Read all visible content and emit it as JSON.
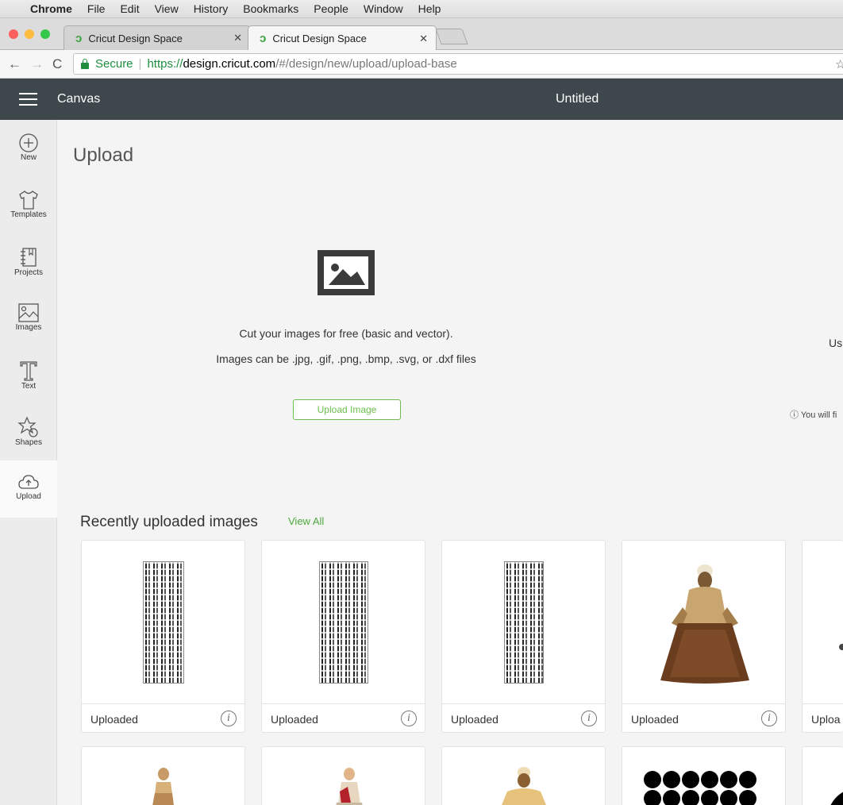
{
  "menubar": {
    "app": "Chrome",
    "items": [
      "File",
      "Edit",
      "View",
      "History",
      "Bookmarks",
      "People",
      "Window",
      "Help"
    ]
  },
  "tabs": [
    {
      "title": "Cricut Design Space",
      "active": false
    },
    {
      "title": "Cricut Design Space",
      "active": true
    }
  ],
  "address": {
    "secure_label": "Secure",
    "scheme": "https://",
    "host": "design.cricut.com",
    "path": "/#/design/new/upload/upload-base"
  },
  "header": {
    "canvas_label": "Canvas",
    "document_title": "Untitled"
  },
  "rail": [
    {
      "label": "New",
      "icon": "plus-circle-icon",
      "active": false
    },
    {
      "label": "Templates",
      "icon": "shirt-icon",
      "active": false
    },
    {
      "label": "Projects",
      "icon": "notebook-icon",
      "active": false
    },
    {
      "label": "Images",
      "icon": "image-icon",
      "active": false
    },
    {
      "label": "Text",
      "icon": "text-t-icon",
      "active": false
    },
    {
      "label": "Shapes",
      "icon": "shapes-icon",
      "active": false
    },
    {
      "label": "Upload",
      "icon": "cloud-upload-icon",
      "active": true
    }
  ],
  "upload": {
    "title": "Upload",
    "line1": "Cut your images for free (basic and vector).",
    "line2": "Images can be .jpg, .gif, .png, .bmp, .svg, or .dxf files",
    "button_label": "Upload Image",
    "right_partial": "Us",
    "fine_print": "ⓘ You will fi"
  },
  "recent": {
    "title": "Recently uploaded images",
    "view_all": "View All",
    "cards": [
      {
        "label": "Uploaded",
        "thumb": "text-strip"
      },
      {
        "label": "Uploaded",
        "thumb": "text-strip"
      },
      {
        "label": "Uploaded",
        "thumb": "text-strip"
      },
      {
        "label": "Uploaded",
        "thumb": "seated-figure"
      },
      {
        "label": "Uploa",
        "thumb": "partial"
      }
    ]
  },
  "colors": {
    "header_bg": "#3d474c",
    "accent_green": "#6cbf4e",
    "link_green": "#4ca83c"
  }
}
